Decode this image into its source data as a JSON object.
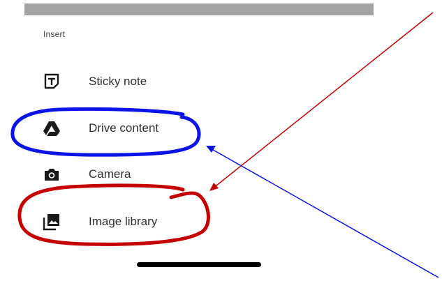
{
  "menu": {
    "header": "Insert",
    "items": [
      {
        "label": "Sticky note",
        "icon": "sticky-note-icon"
      },
      {
        "label": "Drive content",
        "icon": "drive-icon"
      },
      {
        "label": "Camera",
        "icon": "camera-icon"
      },
      {
        "label": "Image library",
        "icon": "image-library-icon"
      }
    ]
  },
  "annotations": {
    "blue_color": "#0a14e6",
    "red_color": "#c40000"
  }
}
